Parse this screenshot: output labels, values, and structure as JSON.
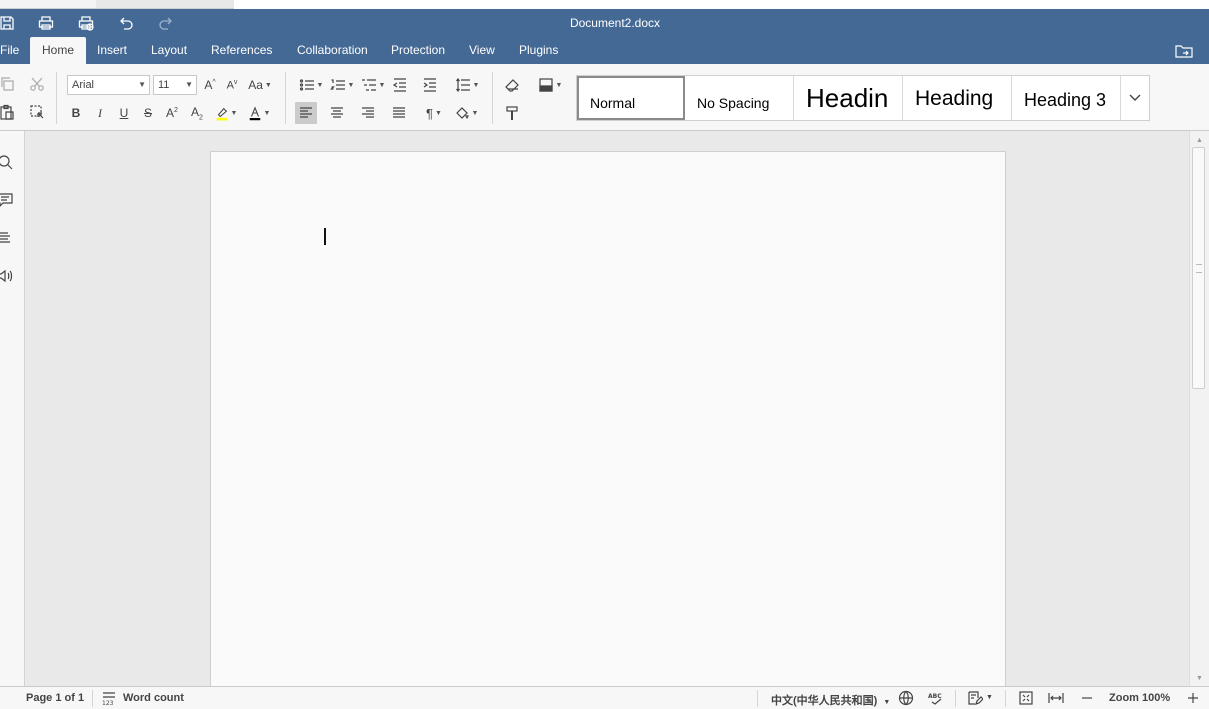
{
  "titlebar": {
    "document_title": "Document2.docx",
    "quick_access": [
      "save-icon",
      "print-icon",
      "quick-print-icon",
      "undo-icon",
      "redo-icon"
    ]
  },
  "menu": {
    "tabs": [
      {
        "label": "File"
      },
      {
        "label": "Home"
      },
      {
        "label": "Insert"
      },
      {
        "label": "Layout"
      },
      {
        "label": "References"
      },
      {
        "label": "Collaboration"
      },
      {
        "label": "Protection"
      },
      {
        "label": "View"
      },
      {
        "label": "Plugins"
      }
    ],
    "active": "Home"
  },
  "toolbar": {
    "font_name": "Arial",
    "font_size": "11",
    "styles": [
      {
        "label": "Normal"
      },
      {
        "label": "No Spacing"
      },
      {
        "label": "Headin"
      },
      {
        "label": "Heading"
      },
      {
        "label": "Heading 3"
      }
    ],
    "highlight_color": "#ffff00",
    "font_color": "#000000"
  },
  "statusbar": {
    "page": "Page 1 of 1",
    "word_count": "Word count",
    "language": "中文(中华人民共和国)",
    "zoom": "Zoom 100%"
  },
  "colors": {
    "header": "#446995",
    "toolbar_bg": "#f7f7f7",
    "canvas_bg": "#e9e9e9"
  }
}
